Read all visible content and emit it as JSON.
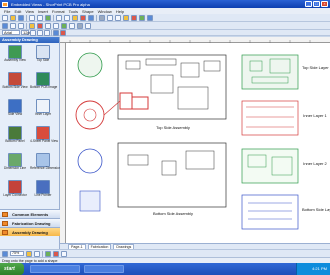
{
  "window": {
    "title": "Embedded Views - ShorPrint PCB Pro alpha"
  },
  "menu": [
    "File",
    "Edit",
    "View",
    "Insert",
    "Format",
    "Tools",
    "Shape",
    "Window",
    "Help"
  ],
  "format": {
    "font": "Arial",
    "size": "12pt",
    "zoom": "75%"
  },
  "shapes_panel": {
    "title": "Assembly Drawing",
    "items": [
      "Assembly View",
      "Top Side",
      "Bottom Side View",
      "Bottom PCB Image",
      "Side View",
      "Inner Layer",
      "Bottom Panel",
      "4-Sheet Panel View",
      "Dimension Line",
      "Reference Dimension",
      "Layer Connector",
      "Line Pointer"
    ],
    "sections": [
      "Common Elements",
      "Fabrication Drawing",
      "Assembly Drawing"
    ]
  },
  "canvas": {
    "labels": {
      "top_assembly": "Top Side Assembly",
      "bottom_assembly": "Bottom Side Assembly",
      "top_layer": "Top Side Layer",
      "inner1": "Inner Layer 1",
      "inner2": "Inner Layer 2",
      "bottom_layer": "Bottom Side Layer"
    },
    "ruler_numbers": [
      "0",
      "1",
      "2",
      "3",
      "4",
      "5",
      "6",
      "7",
      "8",
      "9",
      "10",
      "11",
      "12"
    ]
  },
  "page_tabs": [
    "Page-1",
    "Fabrication",
    "Drawings"
  ],
  "status": {
    "text": "Drag onto the page to add a shape"
  },
  "taskbar": {
    "start": "start",
    "clock": "4:21 PM"
  },
  "colors": {
    "accent": "#2f63bd",
    "pcb_red": "#d43a3a",
    "pcb_green": "#2e9a4a",
    "pcb_blue": "#3a55c8"
  }
}
